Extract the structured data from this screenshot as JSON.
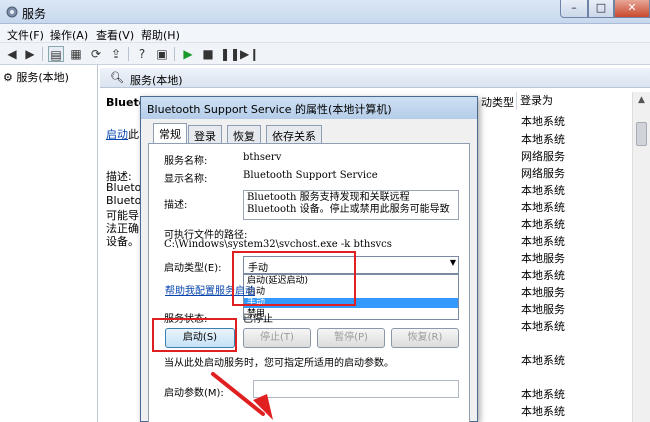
{
  "window": {
    "title": "服务"
  },
  "window_buttons": {
    "minimize": "–",
    "maximize": "□",
    "close": "✕"
  },
  "menu": [
    {
      "label": "文件(F)"
    },
    {
      "label": "操作(A)"
    },
    {
      "label": "查看(V)"
    },
    {
      "label": "帮助(H)"
    }
  ],
  "tree": {
    "root": "服务(本地)"
  },
  "pane": {
    "title": "服务(本地)",
    "service_name": "Blueto",
    "start_link": "启动",
    "start_suffix": "此",
    "desc_lines": [
      "描述:",
      "Blueto",
      "Blueto",
      "可能导",
      "法正确",
      "设备。"
    ]
  },
  "list": {
    "col_type": "动类型",
    "col_logon": "登录为",
    "logon_values": [
      "本地系统",
      "本地系统",
      "网络服务",
      "网络服务",
      "本地系统",
      "本地系统",
      "本地系统",
      "本地系统",
      "本地服务",
      "本地系统",
      "本地服务",
      "本地服务",
      "本地系统",
      "本地系统",
      "本地系统",
      "本地系统"
    ]
  },
  "dialog": {
    "title": "Bluetooth Support Service 的属性(本地计算机)",
    "tabs": [
      "常规",
      "登录",
      "恢复",
      "依存关系"
    ],
    "service_name_label": "服务名称:",
    "service_name_value": "bthserv",
    "display_name_label": "显示名称:",
    "display_name_value": "Bluetooth Support Service",
    "desc_label": "描述:",
    "desc_value": "Bluetooth 服务支持发现和关联远程 Bluetooth 设备。停止或禁用此服务可能导致",
    "path_label": "可执行文件的路径:",
    "path_value": "C:\\Windows\\system32\\svchost.exe -k bthsvcs",
    "startup_type_label": "启动类型(E):",
    "startup_type_value": "手动",
    "startup_options": [
      "启动(延迟启动)",
      "自动",
      "手动",
      "禁用"
    ],
    "help_link": "帮助我配置服务",
    "help_link_tail": "启动",
    "status_label": "服务状态:",
    "status_value": "已停止",
    "buttons": {
      "start": "启动(S)",
      "stop": "停止(T)",
      "pause": "暂停(P)",
      "resume": "恢复(R)"
    },
    "hint": "当从此处启动服务时，您可指定所适用的启动参数。",
    "params_label": "启动参数(M):"
  },
  "colors": {
    "annotation": "#e02020",
    "selection": "#3399ff"
  }
}
